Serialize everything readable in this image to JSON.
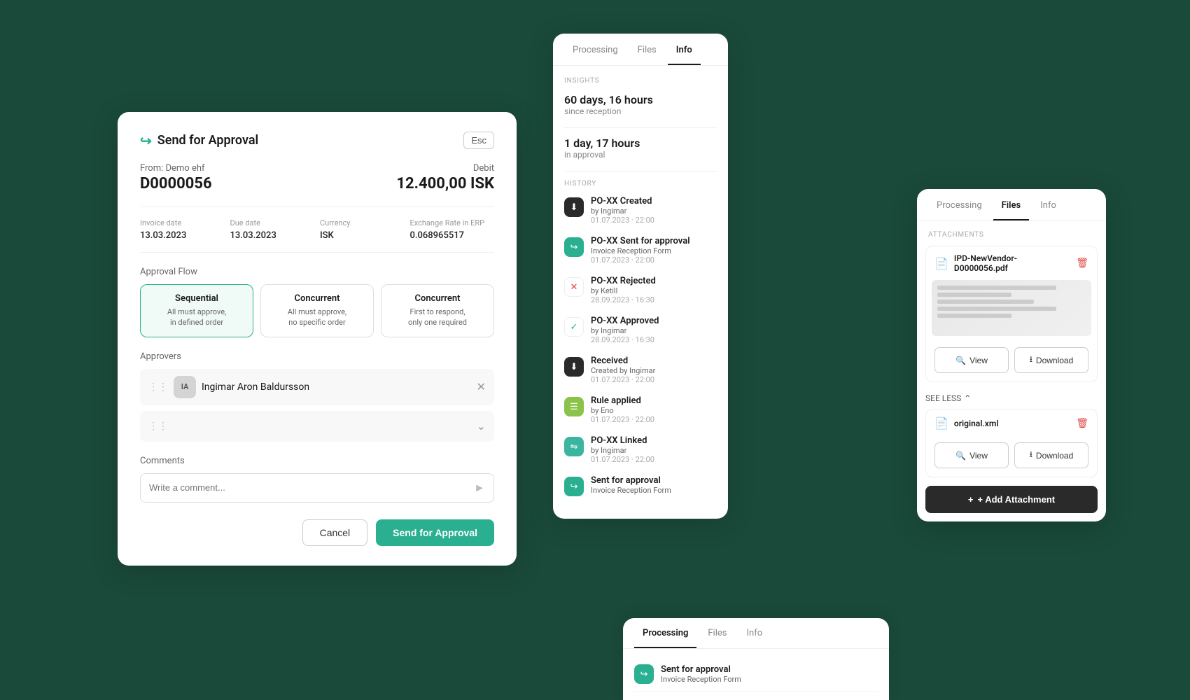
{
  "modal": {
    "title": "Send for Approval",
    "esc_label": "Esc",
    "from_label": "From: Demo ehf",
    "invoice_id": "D0000056",
    "debit_label": "Debit",
    "amount": "12.400,00 ISK",
    "details": {
      "invoice_date_label": "Invoice date",
      "invoice_date_value": "13.03.2023",
      "due_date_label": "Due date",
      "due_date_value": "13.03.2023",
      "currency_label": "Currency",
      "currency_value": "ISK",
      "exchange_label": "Exchange Rate in ERP",
      "exchange_value": "0.068965517"
    },
    "approval_flow_label": "Approval Flow",
    "flow_options": [
      {
        "id": "sequential",
        "title": "Sequential",
        "desc": "All must approve, in defined order",
        "selected": true
      },
      {
        "id": "concurrent_all",
        "title": "Concurrent",
        "desc": "All must approve, no specific order",
        "selected": false
      },
      {
        "id": "concurrent_first",
        "title": "Concurrent",
        "desc": "First to respond, only one required",
        "selected": false
      }
    ],
    "approvers_label": "Approvers",
    "approvers": [
      {
        "initials": "IA",
        "name": "Ingimar Aron Baldursson"
      }
    ],
    "comments_label": "Comments",
    "comment_placeholder": "Write a comment...",
    "cancel_label": "Cancel",
    "send_label": "Send for Approval"
  },
  "panel_info": {
    "tabs": [
      {
        "id": "processing",
        "label": "Processing"
      },
      {
        "id": "files",
        "label": "Files"
      },
      {
        "id": "info",
        "label": "Info",
        "active": true
      }
    ],
    "insights_label": "INSIGHTS",
    "insight1_value": "60 days, 16 hours",
    "insight1_sub": "since reception",
    "insight2_value": "1 day, 17 hours",
    "insight2_sub": "in approval",
    "history_label": "HISTORY",
    "history_items": [
      {
        "icon": "⬇",
        "icon_style": "dark",
        "title": "PO-XX Created",
        "sub": "by Ingimar",
        "date": "01.07.2023 · 22:00"
      },
      {
        "icon": "↗",
        "icon_style": "green-light",
        "title": "PO-XX Sent for approval",
        "sub": "Invoice Reception Form",
        "date": "01.07.2023 · 22:00"
      },
      {
        "icon": "✕",
        "icon_style": "red",
        "title": "PO-XX Rejected",
        "sub": "by Ketill",
        "date": "28.09.2023 · 16:30"
      },
      {
        "icon": "✓",
        "icon_style": "green",
        "title": "PO-XX Approved",
        "sub": "by Ingimar",
        "date": "28.09.2023 · 16:30"
      },
      {
        "icon": "⬇",
        "icon_style": "dark-down",
        "title": "Received",
        "sub": "Created by Ingimar",
        "date": "01.07.2023 · 22:00"
      },
      {
        "icon": "≡",
        "icon_style": "lime",
        "title": "Rule applied",
        "sub": "by Eno",
        "date": "01.07.2023 · 22:00"
      },
      {
        "icon": "⇌",
        "icon_style": "teal",
        "title": "PO-XX Linked",
        "sub": "by Ingimar",
        "date": "01.07.2023 · 22:00"
      },
      {
        "icon": "↗",
        "icon_style": "teal2",
        "title": "Sent for approval",
        "sub": "Invoice Reception Form",
        "date": ""
      }
    ]
  },
  "panel_files": {
    "tabs": [
      {
        "id": "processing",
        "label": "Processing"
      },
      {
        "id": "files",
        "label": "Files",
        "active": true
      },
      {
        "id": "info",
        "label": "Info"
      }
    ],
    "attachments_label": "ATTACHMENTS",
    "attachments": [
      {
        "id": "pdf",
        "name": "IPD-NewVendor-D0000056.pdf",
        "has_preview": true,
        "view_label": "View",
        "download_label": "Download"
      },
      {
        "id": "xml",
        "name": "original.xml",
        "has_preview": false,
        "view_label": "View",
        "download_label": "Download"
      }
    ],
    "see_less_label": "SEE LESS",
    "add_attachment_label": "+ Add Attachment"
  },
  "processing_bottom": {
    "tabs": [
      {
        "id": "processing",
        "label": "Processing",
        "active": true
      },
      {
        "id": "files",
        "label": "Files"
      },
      {
        "id": "info",
        "label": "Info"
      }
    ],
    "items": [
      {
        "icon": "↗",
        "title": "Sent for approval",
        "sub": "Invoice Reception Form"
      }
    ]
  }
}
